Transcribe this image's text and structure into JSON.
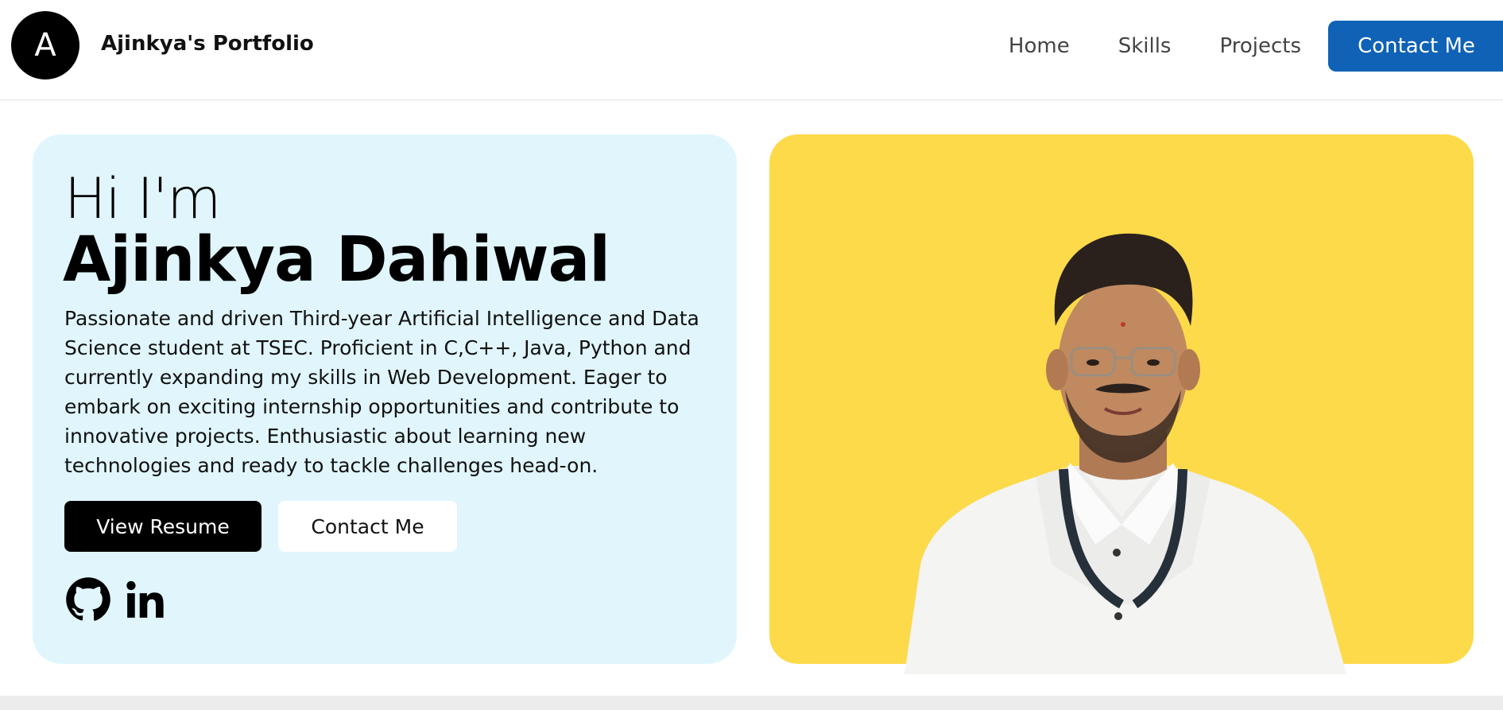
{
  "navbar": {
    "logo_letter": "A",
    "brand": "Ajinkya's Portfolio",
    "links": [
      {
        "label": "Home"
      },
      {
        "label": "Skills"
      },
      {
        "label": "Projects"
      }
    ],
    "cta_label": "Contact Me"
  },
  "hero": {
    "greeting": "Hi I'm",
    "name": "Ajinkya Dahiwal",
    "bio": "Passionate and driven Third-year Artificial Intelligence and Data Science student at TSEC. Proficient in C,C++, Java, Python and currently expanding my skills in Web Development. Eager to embark on exciting internship opportunities and contribute to innovative projects. Enthusiastic about learning new technologies and ready to tackle challenges head-on.",
    "resume_button": "View Resume",
    "contact_button": "Contact Me",
    "social_icons": [
      "github-icon",
      "linkedin-icon"
    ]
  },
  "colors": {
    "intro_card_bg": "#e0f6fc",
    "photo_card_bg": "#fdda4a",
    "nav_cta_bg": "#0f62b5",
    "resume_button_bg": "#000000"
  }
}
